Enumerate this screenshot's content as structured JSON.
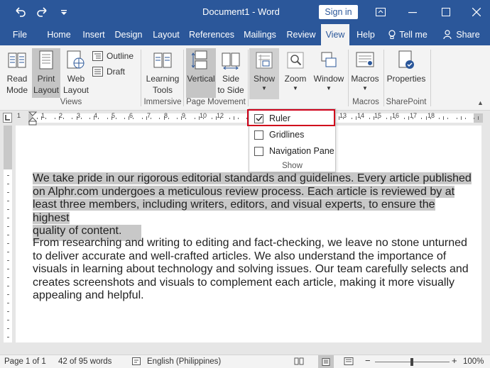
{
  "titlebar": {
    "title": "Document1  -  Word",
    "signin": "Sign in",
    "undo_icon": "undo-icon",
    "redo_icon": "redo-icon",
    "qat_more_icon": "qat-customize-icon"
  },
  "tabs": [
    "File",
    "Home",
    "Insert",
    "Design",
    "Layout",
    "References",
    "Mailings",
    "Review",
    "View",
    "Help",
    "Tell me",
    "Share"
  ],
  "ribbon": {
    "views": {
      "read_mode": [
        "Read",
        "Mode"
      ],
      "print_layout": [
        "Print",
        "Layout"
      ],
      "web_layout": [
        "Web",
        "Layout"
      ],
      "outline": "Outline",
      "draft": "Draft",
      "label": "Views"
    },
    "immersive": {
      "learning_tools": [
        "Learning",
        "Tools"
      ],
      "label": "Immersive"
    },
    "page_movement": {
      "vertical": "Vertical",
      "side_to_side": [
        "Side",
        "to Side"
      ],
      "label": "Page Movement"
    },
    "show": {
      "label": "Show"
    },
    "zoom": {
      "label": "Zoom"
    },
    "window": {
      "label": "Window"
    },
    "macros": {
      "button": "Macros",
      "label": "Macros"
    },
    "sharepoint": {
      "button": "Properties",
      "label": "SharePoint"
    }
  },
  "show_menu": {
    "items": [
      {
        "label": "Ruler",
        "checked": true
      },
      {
        "label": "Gridlines",
        "checked": false
      },
      {
        "label": "Navigation Pane",
        "checked": false
      }
    ],
    "footer": "Show"
  },
  "ruler_numbers": [
    "1",
    "1",
    "2",
    "3",
    "4",
    "5",
    "6",
    "7",
    "8",
    "9",
    "10",
    "12",
    "13",
    "14",
    "15",
    "16",
    "17",
    "18"
  ],
  "document": {
    "paragraph1_lines": [
      "We take pride in our rigorous editorial standards and guidelines. Every article published",
      "on Alphr.com undergoes a meticulous review process. Each article is reviewed by at",
      "least three members, including writers, editors, and visual experts, to ensure the highest",
      "quality of content."
    ],
    "paragraph2_lines": [
      "From researching and writing to editing and fact-checking, we leave no stone unturned",
      "to deliver accurate and well-crafted articles. We also understand the importance of",
      "visuals in learning about technology and solving issues. Our team carefully selects and",
      "creates screenshots and visuals to complement each article, making it more visually",
      "appealing and helpful."
    ]
  },
  "statusbar": {
    "page": "Page 1 of 1",
    "words": "42 of 95 words",
    "language": "English (Philippines)",
    "zoom": "100%"
  },
  "colors": {
    "accent": "#2b579a",
    "highlight_box": "#d0021b",
    "selection": "#c8c8c8"
  }
}
